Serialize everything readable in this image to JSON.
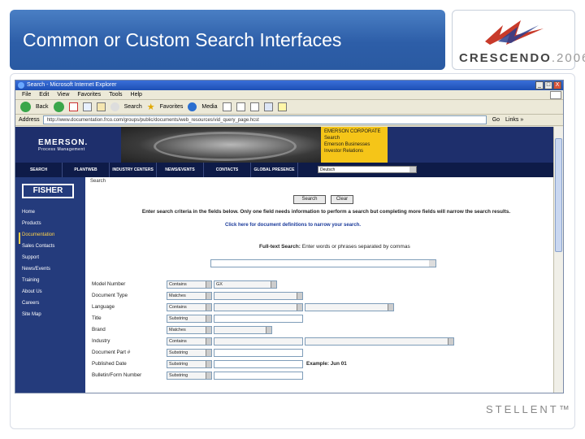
{
  "slide": {
    "title": "Common or Custom Search Interfaces",
    "brand": "CRESCENDO",
    "brand_year": ".2006",
    "footer_brand": "STELLENT™"
  },
  "browser": {
    "window_title": "Search - Microsoft Internet Explorer",
    "window_buttons": [
      "_",
      "□",
      "X"
    ],
    "menu": [
      "File",
      "Edit",
      "View",
      "Favorites",
      "Tools",
      "Help"
    ],
    "toolbar": {
      "back": "Back",
      "search": "Search",
      "favorites": "Favorites",
      "media": "Media"
    },
    "address_label": "Address",
    "address_url": "http://www.documentation.frco.com/groups/public/documents/web_resources/vid_query_page.hcst",
    "go_label": "Go",
    "links_label": "Links »"
  },
  "site": {
    "logo": "EMERSON.",
    "logo_sub": "Process Management",
    "corporate_box": [
      "EMERSON CORPORATE",
      "Search",
      "Emerson Businesses",
      "Investor Relations"
    ],
    "nav": [
      "SEARCH",
      "PLANTWEB",
      "INDUSTRY CENTERS",
      "NEWS/EVENTS",
      "CONTACTS",
      "GLOBAL PRESENCE"
    ],
    "language": "Deutsch",
    "brand_logo": "FISHER",
    "leftnav": [
      "Home",
      "Products",
      "Documentation",
      "Sales Contacts",
      "Support",
      "News/Events",
      "Training",
      "About Us",
      "Careers",
      "Site Map"
    ],
    "active_nav": "Documentation",
    "breadcrumb": "Search",
    "search_button": "Search",
    "clear_button": "Clear",
    "instructions": "Enter search criteria in the fields below. Only one field needs information to perform a search but completing more fields will narrow the search results.",
    "help_link": "Click here for document definitions to narrow your search.",
    "fulltext_label": "Full-text Search:",
    "fulltext_hint": "Enter words or phrases separated by commas",
    "fields": [
      {
        "label": "Model Number",
        "operator": "Contains",
        "value": "GX"
      },
      {
        "label": "Document Type",
        "operator": "Matches",
        "value": ""
      },
      {
        "label": "Language",
        "operator": "Contains",
        "value": ""
      },
      {
        "label": "Title",
        "operator": "Substring",
        "value": ""
      },
      {
        "label": "Brand",
        "operator": "Matches",
        "value": ""
      },
      {
        "label": "Industry",
        "operator": "Contains",
        "value": ""
      },
      {
        "label": "Document Part #",
        "operator": "Substring",
        "value": ""
      },
      {
        "label": "Published Date",
        "operator": "Substring",
        "value": ""
      },
      {
        "label": "Bulletin/Form Number",
        "operator": "Substring",
        "value": ""
      }
    ],
    "date_example": "Example: Jun 01"
  }
}
